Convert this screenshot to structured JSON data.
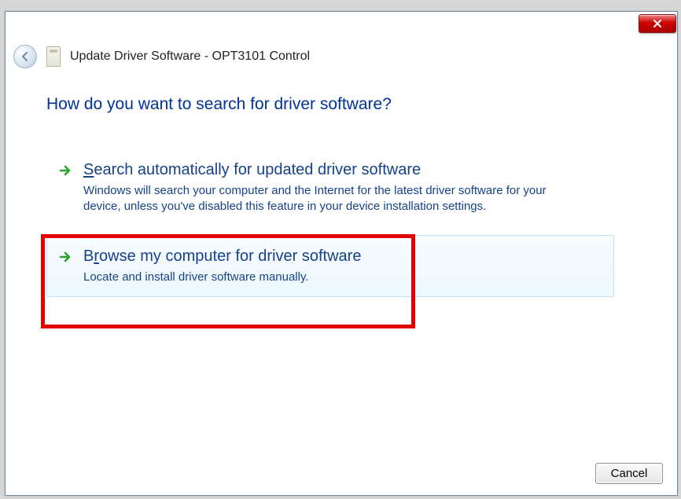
{
  "header": {
    "title": "Update Driver Software - OPT3101 Control"
  },
  "main": {
    "heading": "How do you want to search for driver software?",
    "options": [
      {
        "accel": "S",
        "title_rest": "earch automatically for updated driver software",
        "desc": "Windows will search your computer and the Internet for the latest driver software for your device, unless you've disabled this feature in your device installation settings."
      },
      {
        "title_pre": "B",
        "accel": "r",
        "title_rest": "owse my computer for driver software",
        "desc": "Locate and install driver software manually."
      }
    ]
  },
  "footer": {
    "cancel": "Cancel"
  }
}
